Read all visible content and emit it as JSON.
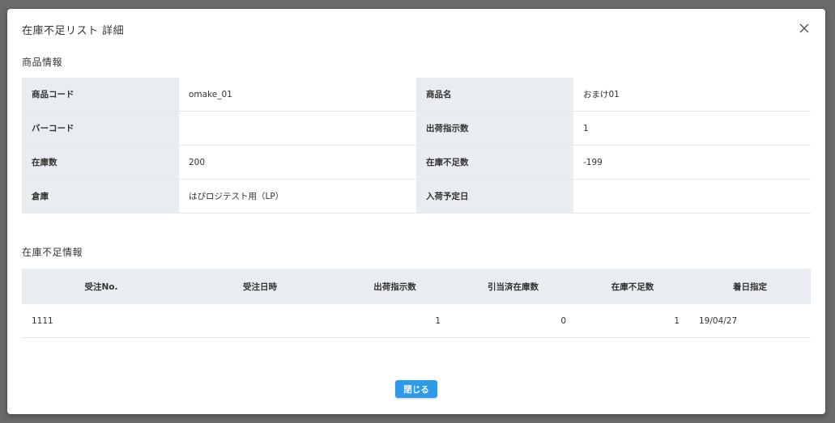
{
  "modal": {
    "title": "在庫不足リスト 詳細",
    "close_icon": "close-icon"
  },
  "product_section": {
    "title": "商品情報",
    "rows": [
      {
        "label1": "商品コード",
        "value1": "omake_01",
        "label2": "商品名",
        "value2": "おまけ01"
      },
      {
        "label1": "バーコード",
        "value1": "",
        "label2": "出荷指示数",
        "value2": "1"
      },
      {
        "label1": "在庫数",
        "value1": "200",
        "label2": "在庫不足数",
        "value2": "-199"
      },
      {
        "label1": "倉庫",
        "value1": "はぴロジテスト用（LP）",
        "label2": "入荷予定日",
        "value2": ""
      }
    ]
  },
  "shortage_section": {
    "title": "在庫不足情報",
    "columns": [
      "受注No.",
      "受注日時",
      "出荷指示数",
      "引当済在庫数",
      "在庫不足数",
      "着日指定"
    ],
    "rows": [
      {
        "order_no": "1111",
        "order_datetime": "",
        "ship_qty": "1",
        "allocated_qty": "0",
        "shortage_qty": "1",
        "delivery_date": "19/04/27"
      }
    ]
  },
  "footer": {
    "close_label": "閉じる"
  },
  "colors": {
    "overlay": "#6b6b6b",
    "label_bg": "#e9edf1",
    "primary_button": "#2f9ae8"
  }
}
